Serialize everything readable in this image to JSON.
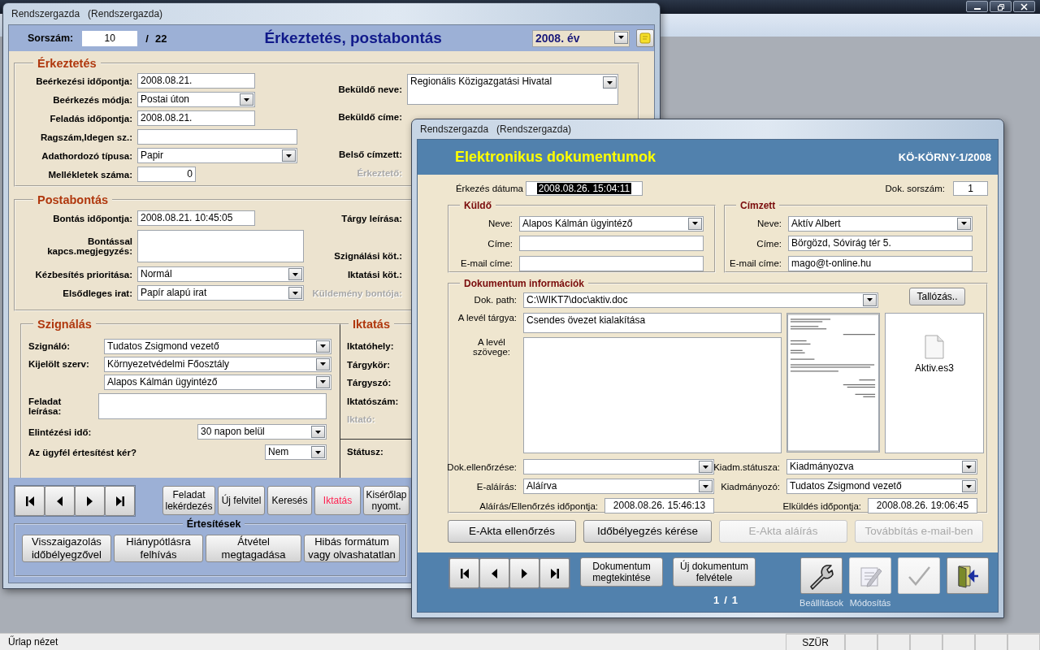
{
  "back_window": {
    "title": "Rendszergazda   (Rendszergazda)",
    "record": {
      "label": "Sorszám:",
      "value": "10",
      "separator": "/",
      "total": "22"
    },
    "heading": "Érkeztetés, postabontás",
    "year": {
      "value": "2008. év"
    },
    "groups": [
      {
        "title": "Érkeztetés",
        "left": [
          {
            "label": "Beérkezési időpontja:",
            "kind": "text",
            "value": "2008.08.21."
          },
          {
            "label": "Beérkezés módja:",
            "kind": "combo",
            "value": "Postai úton"
          },
          {
            "label": "Feladás időpontja:",
            "kind": "text",
            "value": "2008.08.21."
          },
          {
            "label": "Ragszám,Idegen sz.:",
            "kind": "text"
          },
          {
            "label": "Adathordozó típusa:",
            "kind": "combo",
            "value": "Papir"
          },
          {
            "label": "Mellékletek száma:",
            "kind": "number",
            "value": "0"
          }
        ],
        "right": [
          {
            "label": "Beküldő neve:",
            "kind": "memo-combo",
            "value": "Regionális Közigazgatási Hivatal",
            "disabled": false
          },
          {
            "label": "Beküldő címe:",
            "kind": "label",
            "disabled": false
          },
          {
            "label": "Belső címzett:",
            "kind": "label",
            "disabled": false
          },
          {
            "label": "Érkeztető:",
            "kind": "label",
            "disabled": true
          }
        ]
      },
      {
        "title": "Postabontás",
        "left": [
          {
            "label": "Bontás időpontja:",
            "kind": "text",
            "value": "2008.08.21. 10:45:05"
          },
          {
            "label": "Bontással kapcs.megjegyzés:",
            "kind": "memo"
          },
          {
            "label": "Kézbesítés prioritása:",
            "kind": "combo",
            "value": "Normál"
          },
          {
            "label": "Elsődleges irat:",
            "kind": "combo",
            "value": "Papír alapú irat"
          }
        ],
        "right": [
          {
            "label": "Tárgy leírása:",
            "kind": "label",
            "disabled": false
          },
          {
            "label": "Szignálási köt.:",
            "kind": "label",
            "disabled": false
          },
          {
            "label": "Iktatási köt.:",
            "kind": "label",
            "disabled": false
          },
          {
            "label": "Küldemény bontója:",
            "kind": "label",
            "disabled": true
          }
        ]
      }
    ],
    "signing": {
      "title": "Szignálás",
      "rows": [
        {
          "label": "Szignáló:",
          "kind": "combo",
          "value": "Tudatos Zsigmond vezető"
        },
        {
          "label": "Kijelölt szerv:",
          "kind": "combo",
          "value": "Környezetvédelmi Főosztály"
        },
        {
          "kind": "combo",
          "value": "Alapos Kálmán ügyintéző"
        },
        {
          "label": "Feladat leírása:",
          "kind": "memo"
        },
        {
          "label": "Elintézési idő:",
          "kind": "combo",
          "value": "30 napon belül"
        },
        {
          "label": "Az ügyfél értesítést kér?",
          "kind": "combo",
          "value": "Nem"
        }
      ]
    },
    "filing": {
      "title": "Iktatás",
      "labels": [
        {
          "label": "Iktatóhely:",
          "disabled": false
        },
        {
          "label": "Tárgykör:",
          "disabled": false
        },
        {
          "label": "Tárgyszó:",
          "disabled": false
        },
        {
          "label": "Iktatószám:",
          "disabled": false
        },
        {
          "label": "Iktató:",
          "disabled": true
        }
      ],
      "status_label": "Státusz:"
    },
    "buttons": [
      {
        "label": "Feladat lekérdezés",
        "color": "#000000"
      },
      {
        "label": "Új felvitel",
        "color": "#000000"
      },
      {
        "label": "Keresés",
        "color": "#000000"
      },
      {
        "label": "Iktatás",
        "color": "#ff1f4f"
      },
      {
        "label": "Kisérőlap nyomt.",
        "color": "#000000"
      }
    ],
    "notifications": {
      "title": "Értesítések",
      "buttons": [
        "Visszaigazolás időbélyegzővel",
        "Hiánypótlásra felhívás",
        "Átvétel megtagadása",
        "Hibás formátum vagy olvashatatlan"
      ]
    }
  },
  "doc_window": {
    "title": "Rendszergazda   (Rendszergazda)",
    "heading": "Elektronikus dokumentumok",
    "reference": "KÖ-KÖRNY-1/2008",
    "arrival": {
      "label": "Érkezés dátuma",
      "value": "2008.08.26. 15:04:11",
      "highlighted": true
    },
    "doc_number": {
      "label": "Dok. sorszám:",
      "value": "1"
    },
    "sender": {
      "title": "Küldő",
      "fields": [
        {
          "label": "Neve:",
          "kind": "combo",
          "value": "Alapos Kálmán ügyintéző"
        },
        {
          "label": "Címe:",
          "kind": "text"
        },
        {
          "label": "E-mail címe:",
          "kind": "text"
        }
      ]
    },
    "recipient": {
      "title": "Címzett",
      "fields": [
        {
          "label": "Neve:",
          "kind": "combo",
          "value": "Aktív Albert"
        },
        {
          "label": "Címe:",
          "kind": "text",
          "value": "Börgözd, Sóvirág tér 5."
        },
        {
          "label": "E-mail címe:",
          "kind": "text",
          "value": "mago@t-online.hu"
        }
      ]
    },
    "document": {
      "title": "Dokumentum információk",
      "path": {
        "label": "Dok.  path:",
        "kind": "combo",
        "value": "C:\\WIKT7\\doc\\aktiv.doc"
      },
      "browse": "Tallózás..",
      "subject": {
        "label": "A levél tárgya:",
        "kind": "memo",
        "value": "Csendes övezet kialakítása"
      },
      "body": {
        "label": "A levél szövege:",
        "kind": "memo"
      },
      "attachment": "Aktiv.es3",
      "left_fields": [
        {
          "label": "Dok.ellenőrzése:",
          "kind": "combo"
        },
        {
          "label": "E-aláírás:",
          "kind": "combo",
          "value": "Aláírva"
        },
        {
          "label": "Aláírás/Ellenőrzés időpontja:",
          "kind": "center",
          "value": "2008.08.26. 15:46:13"
        }
      ],
      "right_fields": [
        {
          "label": "Kiadm.státusza:",
          "kind": "combo",
          "value": "Kiadmányozva"
        },
        {
          "label": "Kiadmányozó:",
          "kind": "combo",
          "value": "Tudatos Zsigmond vezető"
        },
        {
          "label": "Elküldés időpontja:",
          "kind": "center",
          "value": "2008.08.26. 19:06:45"
        }
      ]
    },
    "actions": [
      {
        "label": "E-Akta ellenőrzés",
        "disabled": false
      },
      {
        "label": "Időbélyegzés kérése",
        "disabled": false
      },
      {
        "label": "E-Akta aláírás",
        "disabled": true
      },
      {
        "label": "Továbbítás e-mail-ben",
        "disabled": true
      }
    ],
    "nav_buttons": [
      "Dokumentum megtekintése",
      "Új dokumentum felvétele"
    ],
    "counter": {
      "current": "1",
      "separator": "/",
      "total": "1"
    },
    "tools": [
      {
        "kind": "settings",
        "label": "Beállítások",
        "disabled": false
      },
      {
        "kind": "edit",
        "label": "Módosítás",
        "disabled": true
      },
      {
        "kind": "confirm",
        "disabled": true
      },
      {
        "kind": "exit",
        "disabled": false
      }
    ]
  },
  "status_bar": {
    "text": "Űrlap nézet",
    "indicators": [
      "SZÜR"
    ]
  }
}
